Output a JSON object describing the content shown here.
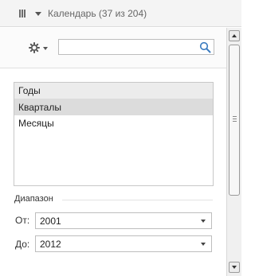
{
  "window": {
    "title": "Календарь (37 из 204)",
    "icons": {
      "menu": "columns-icon",
      "dropdown": "caret-down-icon"
    }
  },
  "toolbar": {
    "settings_icon": "gear-icon",
    "search": {
      "value": "",
      "placeholder": "",
      "icon": "search-icon"
    }
  },
  "levels": {
    "items": [
      {
        "label": "Годы",
        "state": "header"
      },
      {
        "label": "Кварталы",
        "state": "selected"
      },
      {
        "label": "Месяцы",
        "state": "normal"
      }
    ]
  },
  "range": {
    "label": "Диапазон",
    "from": {
      "label": "От:",
      "value": "2001"
    },
    "to": {
      "label": "До:",
      "value": "2012"
    }
  },
  "colors": {
    "selected_row": "#dcdcdc",
    "header_row": "#ececec",
    "title_text": "#666666",
    "search_icon": "#3a7bbf"
  }
}
